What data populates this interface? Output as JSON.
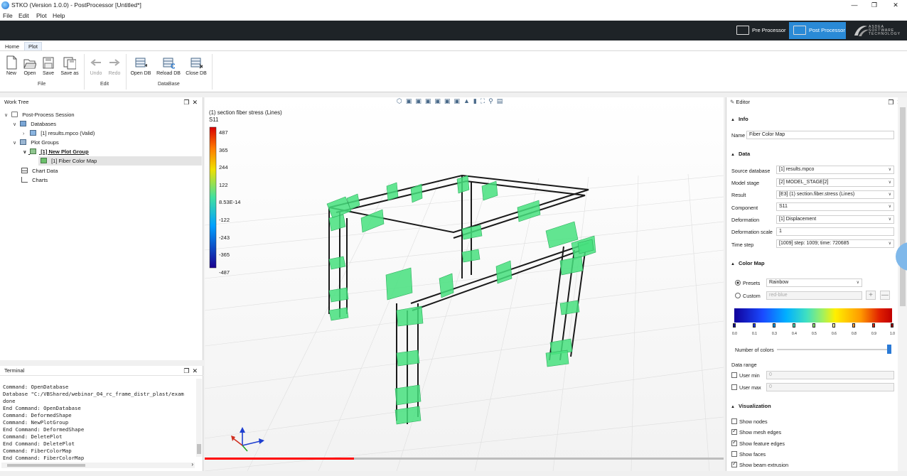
{
  "window": {
    "title": "STKO (Version 1.0.0) - PostProcessor [Untitled*]"
  },
  "menu": [
    "File",
    "Edit",
    "Plot",
    "Help"
  ],
  "modes": {
    "pre": "Pre Processor",
    "post": "Post Processor",
    "brand": "ASDEA SOFTWARE TECHNOLOGY"
  },
  "ribbon_tabs": [
    "Home",
    "Plot"
  ],
  "ribbon": {
    "file": {
      "new": "New",
      "open": "Open",
      "save": "Save",
      "save_as": "Save as",
      "group": "File"
    },
    "edit": {
      "undo": "Undo",
      "redo": "Redo",
      "group": "Edit"
    },
    "db": {
      "open": "Open DB",
      "reload": "Reload DB",
      "close": "Close DB",
      "group": "DataBase"
    }
  },
  "worktree": {
    "title": "Work Tree",
    "items": [
      "Post-Process Session",
      "Databases",
      "[1] results.mpco (Valid)",
      "Plot Groups",
      "[1] New Plot Group",
      "[1] Fiber Color Map",
      "Chart Data",
      "Charts"
    ]
  },
  "terminal": {
    "title": "Terminal",
    "lines": [
      "Command: OpenDatabase",
      "Database \"C:/VBShared/webinar_04_rc_frame_distr_plast/exam",
      "done",
      "End Command: OpenDatabase",
      "Command: DeformedShape",
      "Command: NewPlotGroup",
      "End Command: DeformedShape",
      "Command: DeletePlot",
      "End Command: DeletePlot",
      "Command: FiberColorMap",
      "End Command: FiberColorMap"
    ]
  },
  "legend": {
    "title": "(1) section fiber stress (Lines)",
    "component": "S11",
    "ticks": [
      "487",
      "365",
      "244",
      "122",
      "8.53E-14",
      "-122",
      "-243",
      "-365",
      "-487"
    ]
  },
  "editor": {
    "title": "Editor",
    "info": {
      "section": "Info",
      "name_label": "Name",
      "name_value": "Fiber Color Map"
    },
    "data": {
      "section": "Data",
      "fields": [
        {
          "label": "Source database",
          "value": "[1] results.mpco"
        },
        {
          "label": "Model stage",
          "value": "[2] MODEL_STAGE[2]"
        },
        {
          "label": "Result",
          "value": "[E3] (1) section.fiber.stress (Lines)"
        },
        {
          "label": "Component",
          "value": "S11"
        },
        {
          "label": "Deformation",
          "value": "[1] Displacement"
        },
        {
          "label": "Deformation scale",
          "value": "1"
        },
        {
          "label": "Time step",
          "value": "[1009] step: 1009; time: 720685"
        }
      ]
    },
    "colormap": {
      "section": "Color Map",
      "presets_label": "Presets",
      "presets_value": "Rainbow",
      "custom_label": "Custom",
      "custom_value": "red-blue",
      "stops": [
        "0.0",
        "0.1",
        "0.3",
        "0.4",
        "0.5",
        "0.6",
        "0.8",
        "0.9",
        "1.0"
      ],
      "num_colors_label": "Number of colors",
      "data_range_label": "Data range",
      "user_min_label": "User min",
      "user_min_value": "0",
      "user_max_label": "User max",
      "user_max_value": "0"
    },
    "visualization": {
      "section": "Visualization",
      "items": [
        {
          "label": "Show nodes",
          "checked": false
        },
        {
          "label": "Show mesh edges",
          "checked": true
        },
        {
          "label": "Show feature edges",
          "checked": true
        },
        {
          "label": "Show faces",
          "checked": false
        },
        {
          "label": "Show beam extrusion",
          "checked": true
        }
      ]
    }
  },
  "colors": {
    "accent": "#2a8ad6",
    "banner": "#1e2327",
    "fiber": "#3ee07a",
    "progress": "#ff0000"
  },
  "video_progress": 0.39
}
